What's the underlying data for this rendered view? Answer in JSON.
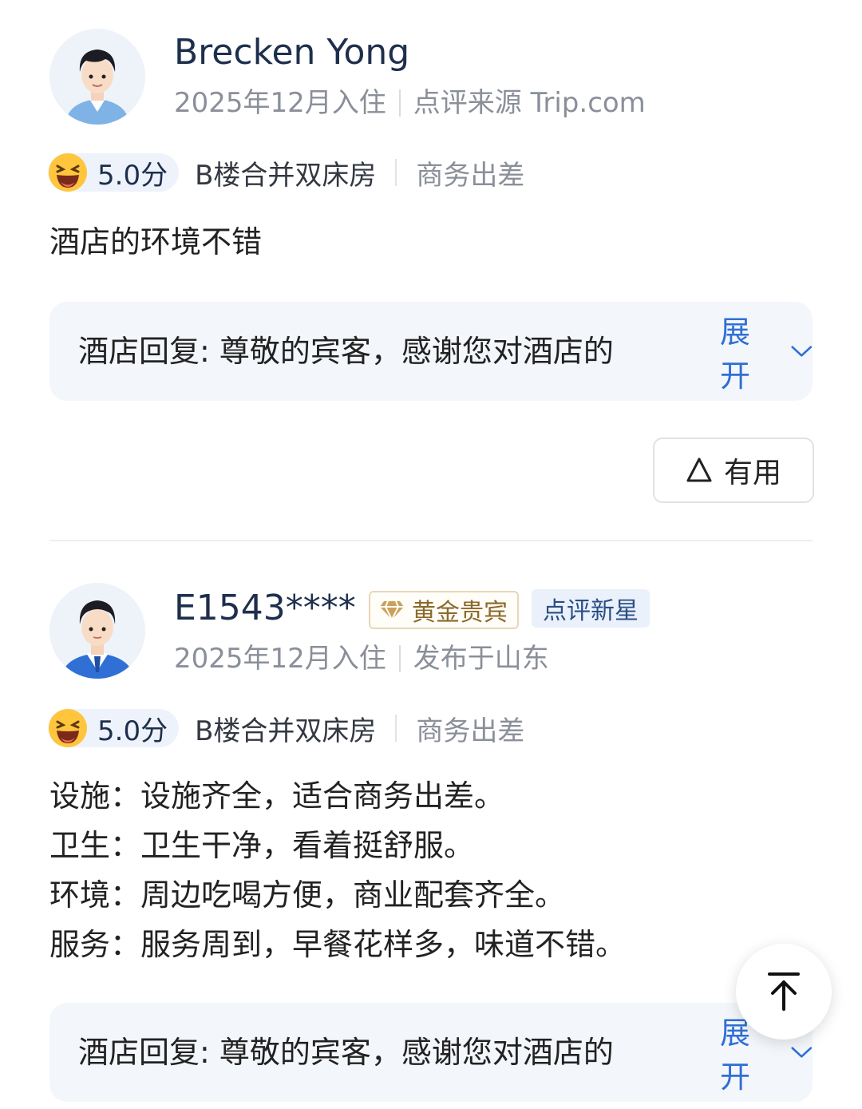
{
  "reviews": [
    {
      "username": "Brecken Yong",
      "stay_date": "2025年12月入住",
      "meta_extra": "点评来源 Trip.com",
      "score": "5.0分",
      "room_type": "B楼合并双床房",
      "trip_type": "商务出差",
      "content": [
        "酒店的环境不错"
      ],
      "reply_text": "酒店回复: 尊敬的宾客，感谢您对酒店的",
      "reply_expand": "展开",
      "useful_label": "有用"
    },
    {
      "username": "E1543****",
      "badge_gold": "黄金贵宾",
      "badge_star": "点评新星",
      "stay_date": "2025年12月入住",
      "meta_extra": "发布于山东",
      "score": "5.0分",
      "room_type": "B楼合并双床房",
      "trip_type": "商务出差",
      "content": [
        "设施：设施齐全，适合商务出差。",
        "卫生：卫生干净，看着挺舒服。",
        "环境：周边吃喝方便，商业配套齐全。",
        "服务：服务周到，早餐花样多，味道不错。"
      ],
      "reply_text": "酒店回复: 尊敬的宾客，感谢您对酒店的",
      "reply_expand": "展开"
    }
  ],
  "colors": {
    "accent_blue": "#2f6fd6",
    "reply_bg": "#f3f6fb",
    "gold_text": "#8a6a2a",
    "star_badge_text": "#2a4e84"
  },
  "icons": {
    "score_emoji": "laughing-face-icon",
    "useful": "triangle-thumb-icon",
    "expand": "chevron-down-icon",
    "gold_badge": "diamond-icon",
    "back_to_top": "arrow-up-icon"
  }
}
